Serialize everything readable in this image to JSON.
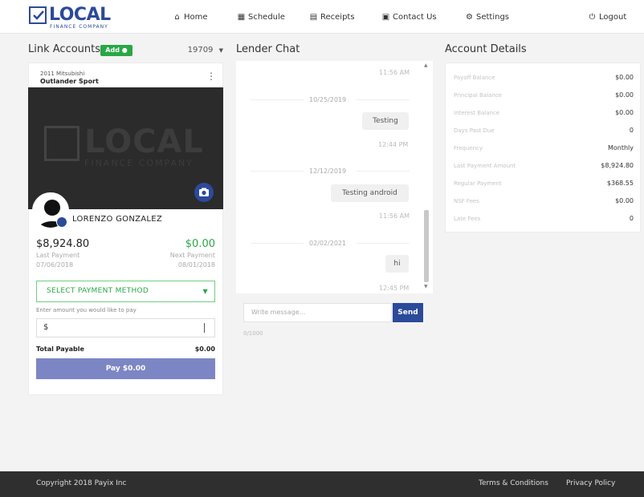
{
  "header": {
    "logo_text": "LOCAL",
    "logo_subtext": "FINANCE COMPANY",
    "nav": [
      {
        "label": "Home",
        "icon": "home-icon",
        "glyph": "⌂"
      },
      {
        "label": "Schedule",
        "icon": "calendar-icon",
        "glyph": "▦"
      },
      {
        "label": "Receipts",
        "icon": "receipt-icon",
        "glyph": "▤"
      },
      {
        "label": "Contact Us",
        "icon": "contact-card-icon",
        "glyph": "▣"
      },
      {
        "label": "Settings",
        "icon": "gear-icon",
        "glyph": "⚙"
      }
    ],
    "logout": {
      "label": "Logout",
      "icon": "power-icon",
      "glyph": "⏻"
    }
  },
  "link_accounts": {
    "title": "Link Accounts",
    "add_label": "Add",
    "selected_account": "19709",
    "vehicle_year_make": "2011 Mitsubishi",
    "vehicle_model": "Outlander Sport",
    "photo_logo_text": "LOCAL",
    "photo_logo_subtext": "FINANCE COMPANY",
    "user_name": "LORENZO GONZALEZ",
    "last_payment_amount": "$8,924.80",
    "last_payment_label": "Last Payment",
    "last_payment_date": "07/06/2018",
    "next_payment_amount": "$0.00",
    "next_payment_label": "Next Payment",
    "next_payment_date": "08/01/2018",
    "payment_method_placeholder": "SELECT PAYMENT METHOD",
    "amount_hint": "Enter amount you would like to pay",
    "currency_symbol": "$",
    "total_label": "Total Payable",
    "total_value": "$0.00",
    "pay_button": "Pay $0.00"
  },
  "chat": {
    "title": "Lender Chat",
    "entries": [
      {
        "kind": "time",
        "text": "11:56 AM"
      },
      {
        "kind": "date",
        "text": "10/25/2019"
      },
      {
        "kind": "bubble",
        "text": "Testing"
      },
      {
        "kind": "time",
        "text": "12:44 PM"
      },
      {
        "kind": "date",
        "text": "12/12/2019"
      },
      {
        "kind": "bubble",
        "text": "Testing android"
      },
      {
        "kind": "time",
        "text": "11:56 AM"
      },
      {
        "kind": "date",
        "text": "02/02/2021"
      },
      {
        "kind": "bubble",
        "text": "hi"
      },
      {
        "kind": "time",
        "text": "12:45 PM"
      }
    ],
    "input_placeholder": "Write message...",
    "send_label": "Send",
    "char_count": "0/1000"
  },
  "account_details": {
    "title": "Account Details",
    "rows": [
      {
        "label": "Payoff Balance",
        "value": "$0.00"
      },
      {
        "label": "Principal Balance",
        "value": "$0.00"
      },
      {
        "label": "Interest Balance",
        "value": "$0.00"
      },
      {
        "label": "Days Past Due",
        "value": "0"
      },
      {
        "label": "Frequency",
        "value": "Monthly"
      },
      {
        "label": "Last Payment Amount",
        "value": "$8,924.80"
      },
      {
        "label": "Regular Payment",
        "value": "$368.55"
      },
      {
        "label": "NSF Fees",
        "value": "$0.00"
      },
      {
        "label": "Late Fees",
        "value": "0"
      }
    ]
  },
  "footer": {
    "copyright": "Copyright 2018 Payix Inc",
    "terms": "Terms & Conditions",
    "privacy": "Privacy Policy"
  },
  "colors": {
    "brand_blue": "#2c4a9a",
    "success_green": "#29a745",
    "pay_button": "#7c86c4",
    "footer_bg": "#2f2f2f"
  }
}
